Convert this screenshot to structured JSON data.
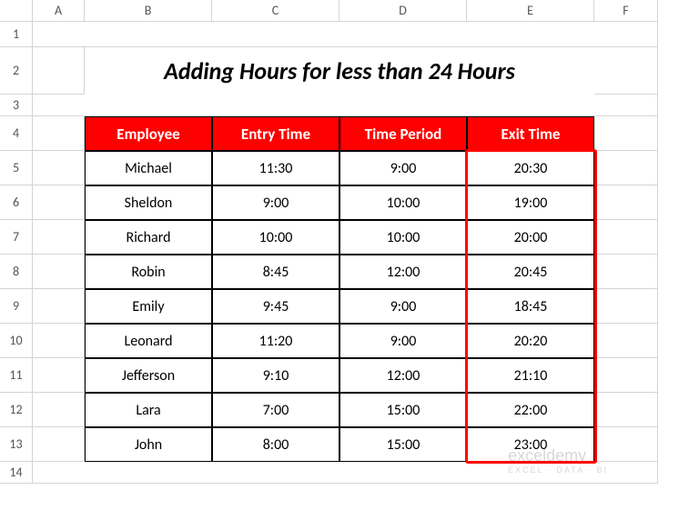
{
  "columns": [
    "A",
    "B",
    "C",
    "D",
    "E",
    "F"
  ],
  "rows": [
    "1",
    "2",
    "3",
    "4",
    "5",
    "6",
    "7",
    "8",
    "9",
    "10",
    "11",
    "12",
    "13",
    "14"
  ],
  "title": "Adding Hours for less than 24 Hours",
  "headers": {
    "employee": "Employee",
    "entry": "Entry Time",
    "period": "Time Period",
    "exit": "Exit Time"
  },
  "data": [
    {
      "employee": "Michael",
      "entry": "11:30",
      "period": "9:00",
      "exit": "20:30"
    },
    {
      "employee": "Sheldon",
      "entry": "9:00",
      "period": "10:00",
      "exit": "19:00"
    },
    {
      "employee": "Richard",
      "entry": "10:00",
      "period": "10:00",
      "exit": "20:00"
    },
    {
      "employee": "Robin",
      "entry": "8:45",
      "period": "12:00",
      "exit": "20:45"
    },
    {
      "employee": "Emily",
      "entry": "9:45",
      "period": "9:00",
      "exit": "18:45"
    },
    {
      "employee": "Leonard",
      "entry": "11:20",
      "period": "9:00",
      "exit": "20:20"
    },
    {
      "employee": "Jefferson",
      "entry": "9:10",
      "period": "12:00",
      "exit": "21:10"
    },
    {
      "employee": "Lara",
      "entry": "7:00",
      "period": "15:00",
      "exit": "22:00"
    },
    {
      "employee": "John",
      "entry": "8:00",
      "period": "15:00",
      "exit": "23:00"
    }
  ],
  "watermark": {
    "main": "exceldemy",
    "sub": "EXCEL · DATA · BI"
  },
  "chart_data": {
    "type": "table",
    "title": "Adding Hours for less than 24 Hours",
    "columns": [
      "Employee",
      "Entry Time",
      "Time Period",
      "Exit Time"
    ],
    "rows": [
      [
        "Michael",
        "11:30",
        "9:00",
        "20:30"
      ],
      [
        "Sheldon",
        "9:00",
        "10:00",
        "19:00"
      ],
      [
        "Richard",
        "10:00",
        "10:00",
        "20:00"
      ],
      [
        "Robin",
        "8:45",
        "12:00",
        "20:45"
      ],
      [
        "Emily",
        "9:45",
        "9:00",
        "18:45"
      ],
      [
        "Leonard",
        "11:20",
        "9:00",
        "20:20"
      ],
      [
        "Jefferson",
        "9:10",
        "12:00",
        "21:10"
      ],
      [
        "Lara",
        "7:00",
        "15:00",
        "22:00"
      ],
      [
        "John",
        "8:00",
        "15:00",
        "23:00"
      ]
    ]
  }
}
